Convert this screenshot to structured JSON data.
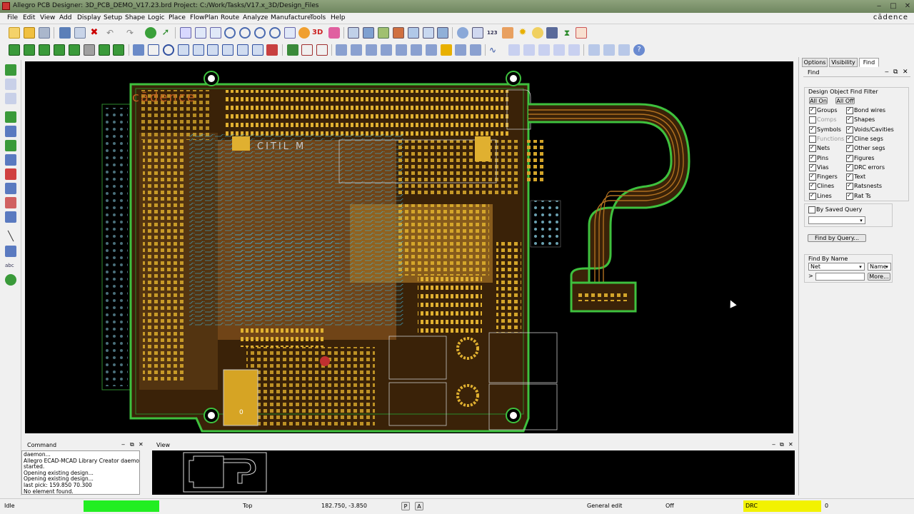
{
  "window": {
    "title": "Allegro PCB Designer: 3D_PCB_DEMO_V17.23.brd  Project: C:/Work/Tasks/V17.x_3D/Design_Files",
    "brand": "cādence"
  },
  "menu": [
    "File",
    "Edit",
    "View",
    "Add",
    "Display",
    "Setup",
    "Shape",
    "Logic",
    "Place",
    "FlowPlan",
    "Route",
    "Analyze",
    "Manufacture",
    "Tools",
    "Help"
  ],
  "canvas": {
    "silk_brand": "cādence",
    "silk_text": "CITIL M",
    "pad_label": "0",
    "colors": {
      "background": "#000000",
      "outline": "#3ec13e",
      "copper": "#d2a020",
      "trace": "#42b4d6",
      "plane": "#7a4a1a"
    }
  },
  "right_panel": {
    "tabs": [
      "Options",
      "Visibility",
      "Find"
    ],
    "active_tab": "Find",
    "header": "Find",
    "filter_title": "Design Object Find Filter",
    "all_on": "All On",
    "all_off": "All Off",
    "left_items": [
      {
        "label": "Groups",
        "checked": true
      },
      {
        "label": "Comps",
        "checked": false,
        "disabled": true
      },
      {
        "label": "Symbols",
        "checked": true
      },
      {
        "label": "Functions",
        "checked": false,
        "disabled": true
      },
      {
        "label": "Nets",
        "checked": true
      },
      {
        "label": "Pins",
        "checked": true
      },
      {
        "label": "Vias",
        "checked": true
      },
      {
        "label": "Fingers",
        "checked": true
      },
      {
        "label": "Clines",
        "checked": true
      },
      {
        "label": "Lines",
        "checked": true
      }
    ],
    "right_items": [
      {
        "label": "Bond wires",
        "checked": true
      },
      {
        "label": "Shapes",
        "checked": true
      },
      {
        "label": "Voids/Cavities",
        "checked": true
      },
      {
        "label": "Cline segs",
        "checked": true
      },
      {
        "label": "Other segs",
        "checked": true
      },
      {
        "label": "Figures",
        "checked": true
      },
      {
        "label": "DRC errors",
        "checked": true
      },
      {
        "label": "Text",
        "checked": true
      },
      {
        "label": "Ratsnests",
        "checked": true
      },
      {
        "label": "Rat Ts",
        "checked": true
      }
    ],
    "by_saved_query": "By Saved Query",
    "find_by_query": "Find by Query...",
    "find_by_name_title": "Find By Name",
    "name_type": "Net",
    "name_mode": "Name",
    "name_prefix": ">",
    "more": "More..."
  },
  "command_panel": {
    "title": "Command",
    "lines": [
      "daemon...",
      "Allegro ECAD-MCAD Library Creator daemon",
      "started.",
      "Opening existing design...",
      "Opening existing design...",
      "last pick:  159.850 70.300",
      "No element found."
    ]
  },
  "view_panel": {
    "title": "View"
  },
  "status": {
    "mode": "Idle",
    "layer": "Top",
    "coords": "182.750, -3.850",
    "p_btn": "P",
    "a_btn": "A",
    "edit_mode": "General edit",
    "off": "Off",
    "drc": "DRC",
    "drc_count": "0",
    "colors": {
      "idle_indicator": "#22ee22",
      "drc_indicator": "#f2f200"
    }
  }
}
